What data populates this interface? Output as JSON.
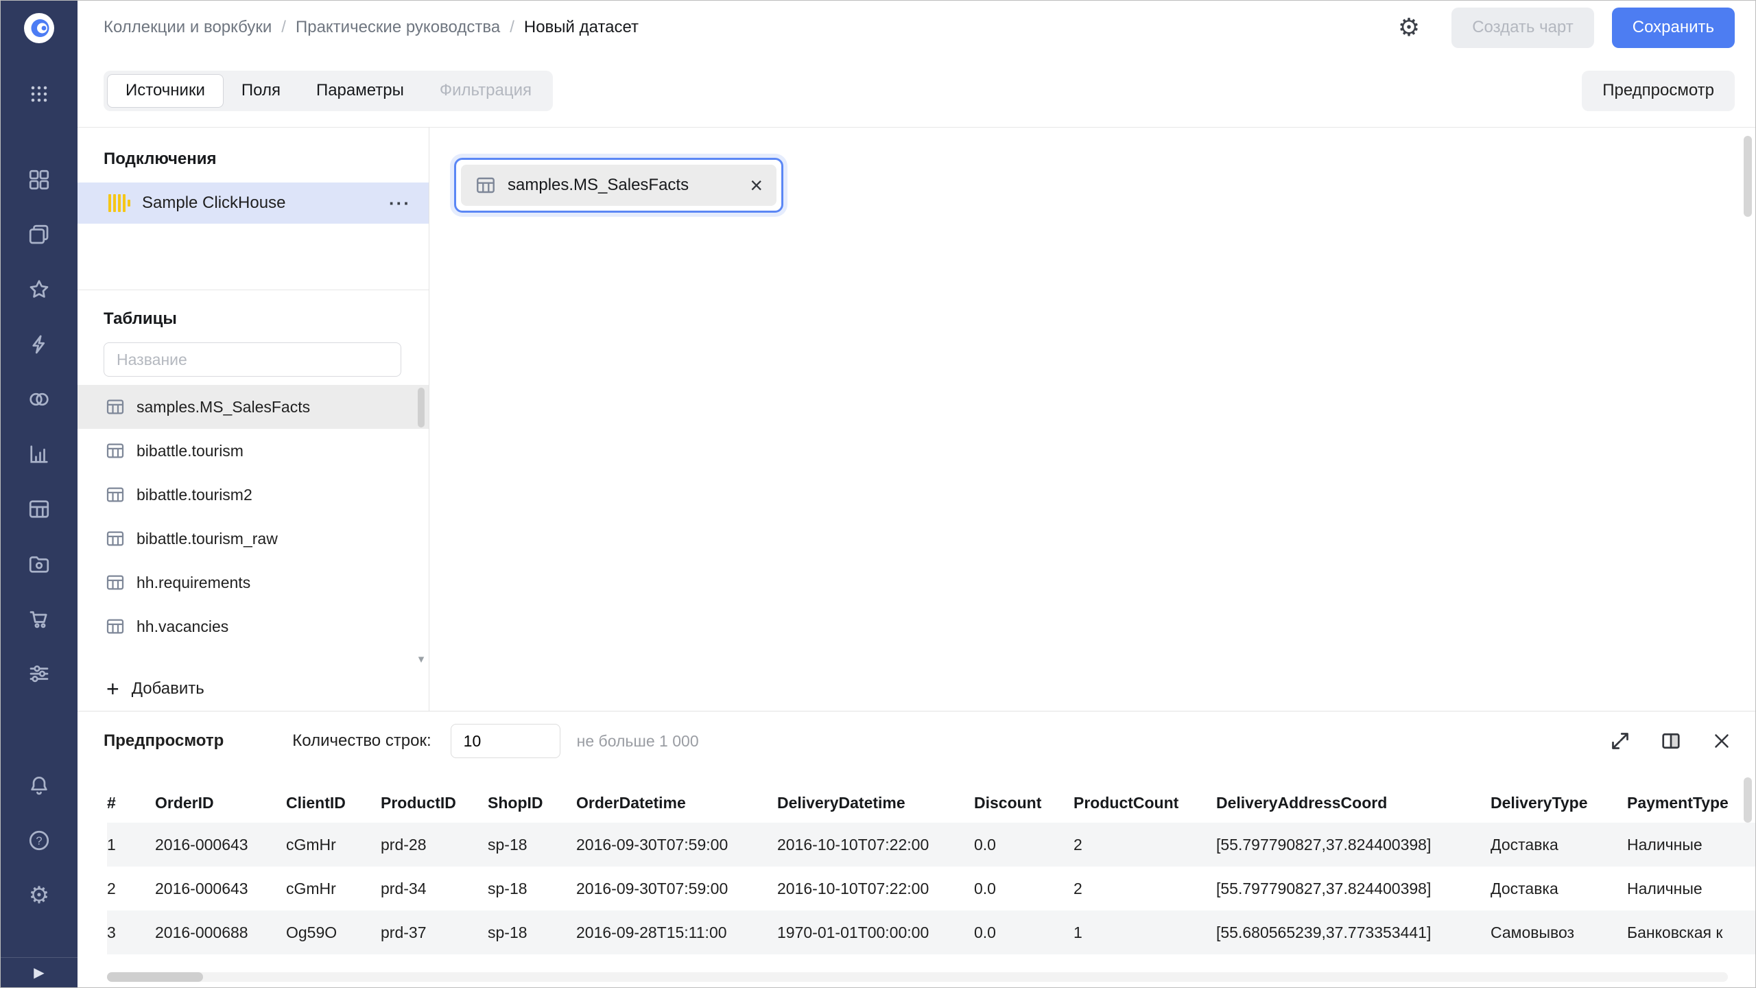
{
  "colors": {
    "accent": "#4d7df2",
    "sidebar": "#2f3a5f",
    "clickhouse_yellow": "#f5c617",
    "connection_selected_bg": "#dde4f9",
    "table_selected_bg": "#ececec"
  },
  "sidebar": {
    "icons": [
      "datalens-logo",
      "apps-grid-icon",
      "tiles-icon",
      "collections-icon",
      "favorites-star-icon",
      "connections-bolt-icon",
      "datasets-circles-icon",
      "charts-icon",
      "table-service-icon",
      "storage-folder-icon",
      "marketplace-cart-icon",
      "settings-sliders-icon",
      "notifications-bell-icon",
      "help-icon",
      "settings-gear-icon",
      "expand-sidebar-icon"
    ]
  },
  "header": {
    "breadcrumb": [
      "Коллекции и воркбуки",
      "Практические руководства",
      "Новый датасет"
    ],
    "separator": "/",
    "icons": [
      "gear-icon"
    ],
    "buttons": {
      "create_chart": "Создать чарт",
      "save": "Сохранить"
    }
  },
  "tabs": {
    "items": [
      {
        "label": "Источники",
        "state": "active"
      },
      {
        "label": "Поля",
        "state": "normal"
      },
      {
        "label": "Параметры",
        "state": "normal"
      },
      {
        "label": "Фильтрация",
        "state": "disabled"
      }
    ],
    "preview_button": "Предпросмотр"
  },
  "connections_panel": {
    "title": "Подключения",
    "connections": [
      {
        "name": "Sample ClickHouse",
        "selected": true
      }
    ],
    "more_icon": "ellipsis-menu-icon",
    "tables_title": "Таблицы",
    "search_placeholder": "Название",
    "tables": [
      {
        "name": "samples.MS_SalesFacts",
        "selected": true
      },
      {
        "name": "bibattle.tourism",
        "selected": false
      },
      {
        "name": "bibattle.tourism2",
        "selected": false
      },
      {
        "name": "bibattle.tourism_raw",
        "selected": false
      },
      {
        "name": "hh.requirements",
        "selected": false
      },
      {
        "name": "hh.vacancies",
        "selected": false
      }
    ],
    "add_button": "Добавить"
  },
  "canvas": {
    "selected_source": "samples.MS_SalesFacts",
    "icons": [
      "table-icon",
      "close-icon"
    ]
  },
  "preview": {
    "title": "Предпросмотр",
    "row_count_label": "Количество строк:",
    "row_count_value": "10",
    "row_count_hint": "не больше 1 000",
    "header_icons": [
      "expand-icon",
      "split-view-icon",
      "close-icon"
    ],
    "columns": [
      "#",
      "OrderID",
      "ClientID",
      "ProductID",
      "ShopID",
      "OrderDatetime",
      "DeliveryDatetime",
      "Discount",
      "ProductCount",
      "DeliveryAddressCoord",
      "DeliveryType",
      "PaymentType"
    ],
    "rows": [
      [
        "1",
        "2016-000643",
        "cGmHr",
        "prd-28",
        "sp-18",
        "2016-09-30T07:59:00",
        "2016-10-10T07:22:00",
        "0.0",
        "2",
        "[55.797790827,37.824400398]",
        "Доставка",
        "Наличные"
      ],
      [
        "2",
        "2016-000643",
        "cGmHr",
        "prd-34",
        "sp-18",
        "2016-09-30T07:59:00",
        "2016-10-10T07:22:00",
        "0.0",
        "2",
        "[55.797790827,37.824400398]",
        "Доставка",
        "Наличные"
      ],
      [
        "3",
        "2016-000688",
        "Og59O",
        "prd-37",
        "sp-18",
        "2016-09-28T15:11:00",
        "1970-01-01T00:00:00",
        "0.0",
        "1",
        "[55.680565239,37.773353441]",
        "Самовывоз",
        "Банковская к"
      ]
    ]
  }
}
